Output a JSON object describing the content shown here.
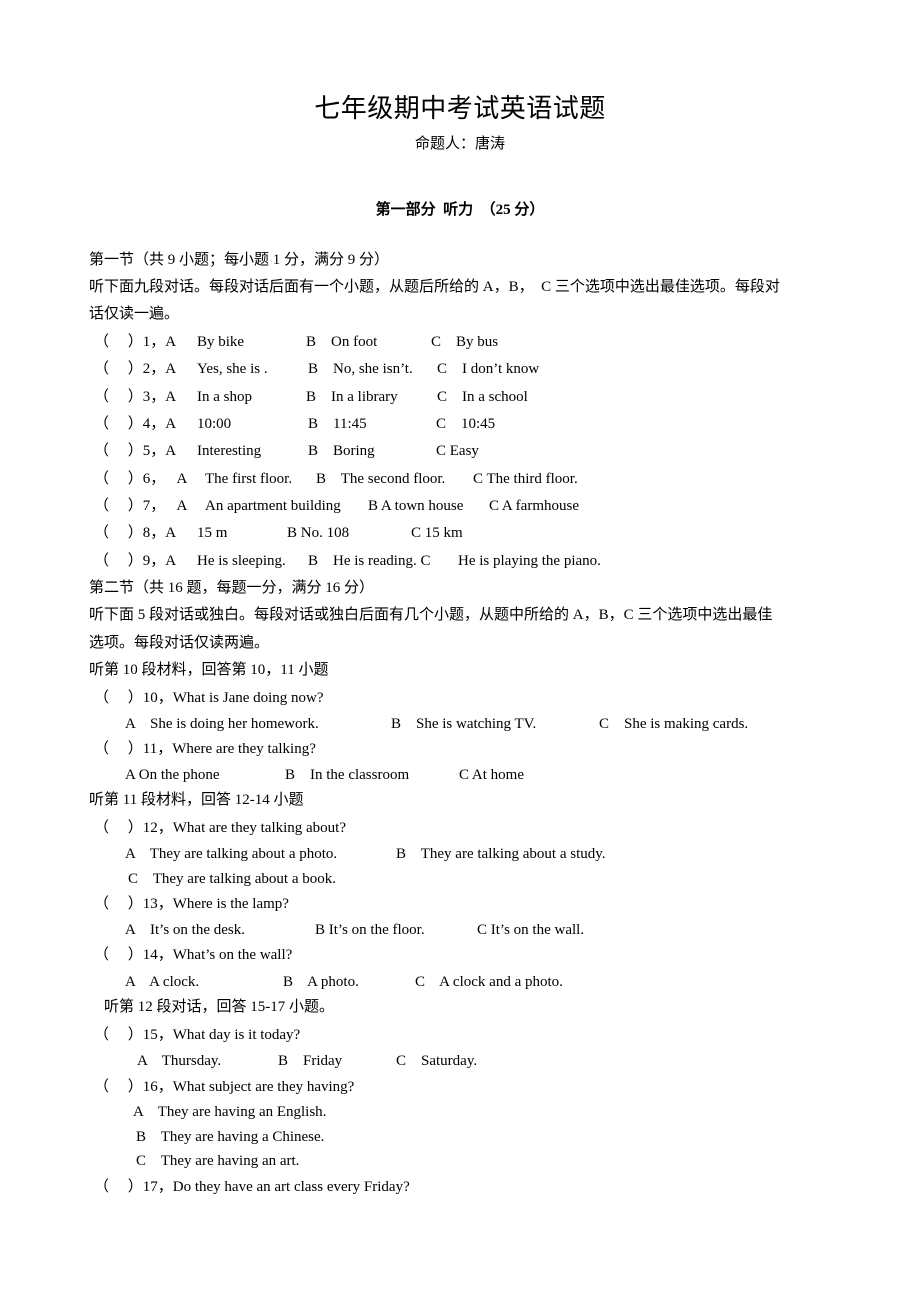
{
  "header": {
    "title": "七年级期中考试英语试题",
    "author": "命题人：唐涛",
    "part_heading": "第一部分  听力  （25 分）"
  },
  "section1": {
    "heading": "第一节（共 9 小题；每小题 1 分，满分 9 分）",
    "instruction_line1": "听下面九段对话。每段对话后面有一个小题，从题后所给的 A，B，  C 三个选项中选出最佳选项。每段对",
    "instruction_line2": "话仅读一遍。",
    "questions": [
      {
        "prefix": "（     ）1，A",
        "a": "By bike",
        "b": "B    On foot",
        "c": "C    By bus"
      },
      {
        "prefix": "（     ）2，A",
        "a": "Yes, she is .",
        "b": "B    No, she isn’t.",
        "c": "C    I don’t know"
      },
      {
        "prefix": "（     ）3，A",
        "a": "In a shop",
        "b": "B    In a library",
        "c": "C    In a school"
      },
      {
        "prefix": "（     ）4，A",
        "a": "10:00",
        "b": "B    11:45",
        "c": "C    10:45"
      },
      {
        "prefix": "（     ）5，A",
        "a": "Interesting",
        "b": "B    Boring",
        "c": "C Easy"
      },
      {
        "prefix": "（     ）6，   A",
        "a": "The first floor.",
        "b": "B    The second floor.",
        "c": "C The third floor."
      },
      {
        "prefix": "（     ）7，   A",
        "a": "An apartment building",
        "b": "B A town house",
        "c": "C A farmhouse"
      },
      {
        "prefix": "（     ）8，A",
        "a": "15 m",
        "b": "B No. 108",
        "c": "C 15 km"
      },
      {
        "prefix": "（     ）9，A",
        "a": "He is sleeping.",
        "b": "B    He is reading. C",
        "c": "He is playing the piano."
      }
    ]
  },
  "section2": {
    "heading": "第二节（共 16 题，每题一分，满分 16 分）",
    "instruction_line1": "听下面 5 段对话或独白。每段对话或独白后面有几个小题，从题中所给的 A，B，C 三个选项中选出最佳",
    "instruction_line2": "选项。每段对话仅读两遍。",
    "groups": [
      {
        "label": "听第 10 段材料，回答第 10，11 小题",
        "questions": [
          {
            "stem": "（     ）10，What is Jane doing now?",
            "options": [
              "A    She is doing her homework.",
              "B    She is watching TV.",
              "C    She is making cards."
            ]
          },
          {
            "stem": "（     ）11，Where are they talking?",
            "options": [
              "A On the phone",
              "B    In the classroom",
              "C At home"
            ]
          }
        ]
      },
      {
        "label": "听第 11 段材料，回答 12-14 小题",
        "questions": [
          {
            "stem": "（     ）12，What are they talking about?",
            "options": [
              "A    They are talking about a photo.",
              "B    They are talking about a study.",
              "C    They are talking about a book."
            ]
          },
          {
            "stem": "（     ）13，Where is the lamp?",
            "options": [
              "A    It’s on the desk.",
              "B It’s on the floor.",
              "C It’s on the wall."
            ]
          },
          {
            "stem": "（     ）14，What’s on the wall?",
            "options": [
              "A    A clock.",
              "B    A photo.",
              "C    A clock and a photo."
            ]
          }
        ]
      },
      {
        "label": "听第 12 段对话，回答 15-17 小题。",
        "questions": [
          {
            "stem": "（     ）15，What day is it today?",
            "options": [
              "A    Thursday.",
              "B    Friday",
              "C    Saturday."
            ]
          },
          {
            "stem": "（     ）16，What subject are they having?",
            "options": [
              "A    They are having an English.",
              "B    They are having a Chinese.",
              "C    They are having an art."
            ]
          },
          {
            "stem": "（     ）17，Do they have an art class every Friday?",
            "options": []
          }
        ]
      }
    ]
  }
}
